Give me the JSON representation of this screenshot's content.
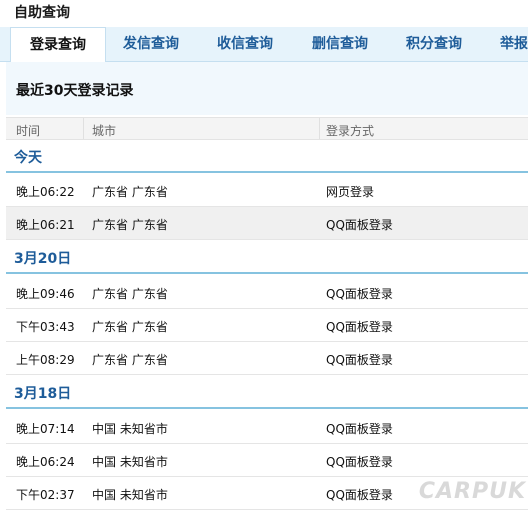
{
  "page_title": "自助查询",
  "tabs": [
    {
      "label": "登录查询",
      "active": true
    },
    {
      "label": "发信查询",
      "active": false
    },
    {
      "label": "收信查询",
      "active": false
    },
    {
      "label": "删信查询",
      "active": false
    },
    {
      "label": "积分查询",
      "active": false
    },
    {
      "label": "举报",
      "active": false
    }
  ],
  "section_title": "最近30天登录记录",
  "columns": {
    "time": "时间",
    "city": "城市",
    "method": "登录方式"
  },
  "groups": [
    {
      "date": "今天",
      "rows": [
        {
          "time": "晚上06:22",
          "city": "广东省 广东省",
          "method": "网页登录"
        },
        {
          "time": "晚上06:21",
          "city": "广东省 广东省",
          "method": "QQ面板登录"
        }
      ]
    },
    {
      "date": "3月20日",
      "rows": [
        {
          "time": "晚上09:46",
          "city": "广东省 广东省",
          "method": "QQ面板登录"
        },
        {
          "time": "下午03:43",
          "city": "广东省 广东省",
          "method": "QQ面板登录"
        },
        {
          "time": "上午08:29",
          "city": "广东省 广东省",
          "method": "QQ面板登录"
        }
      ]
    },
    {
      "date": "3月18日",
      "rows": [
        {
          "time": "晚上07:14",
          "city": "中国 未知省市",
          "method": "QQ面板登录"
        },
        {
          "time": "晚上06:24",
          "city": "中国 未知省市",
          "method": "QQ面板登录"
        },
        {
          "time": "下午02:37",
          "city": "中国 未知省市",
          "method": "QQ面板登录"
        }
      ]
    }
  ],
  "watermark": "CARPUK"
}
